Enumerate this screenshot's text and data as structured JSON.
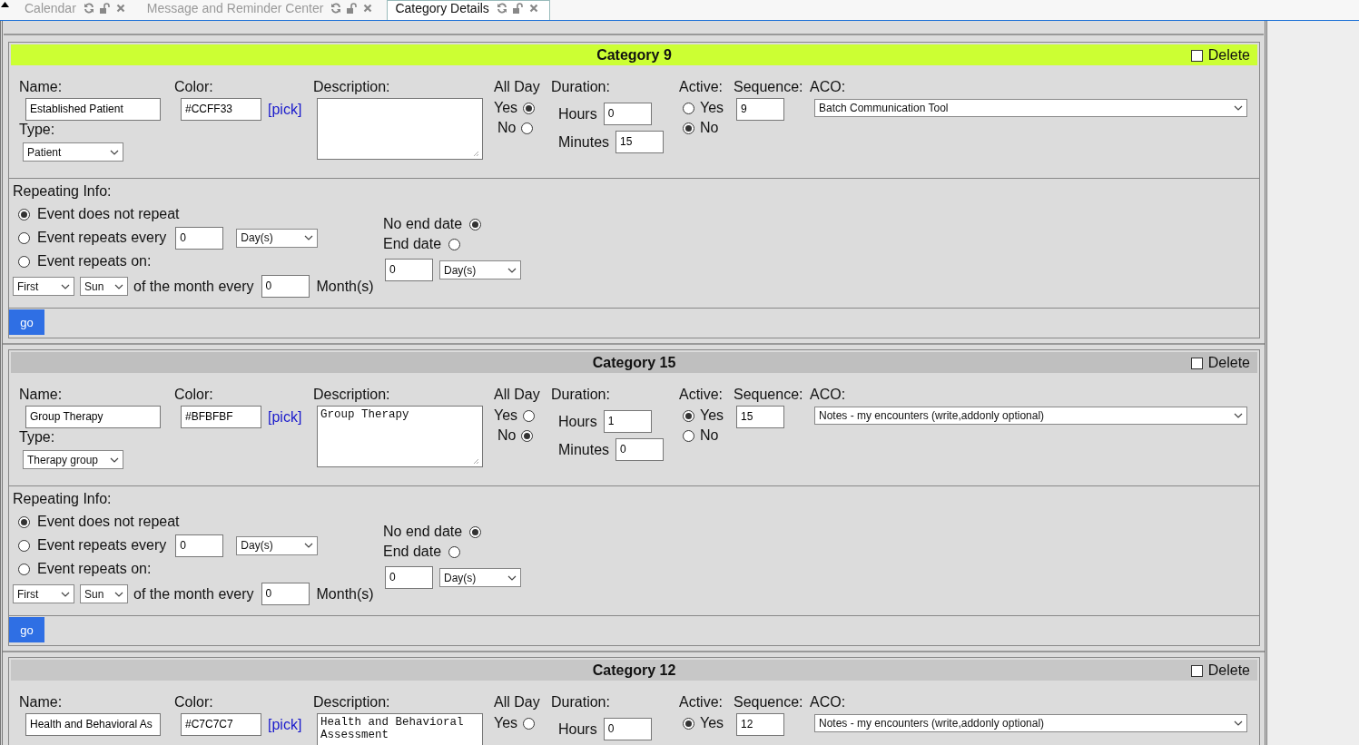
{
  "tabs": [
    {
      "label": "Calendar",
      "selected": false
    },
    {
      "label": "Message and Reminder Center",
      "selected": false
    },
    {
      "label": "Category Details",
      "selected": true
    }
  ],
  "categories": [
    {
      "title": "Category 9",
      "delete": {
        "label": "Delete",
        "checked": false
      },
      "name": {
        "label": "Name:",
        "value": "Established Patient"
      },
      "color": {
        "label": "Color:",
        "value": "#CCFF33",
        "link": "[pick]"
      },
      "type": {
        "label": "Type:",
        "value": "Patient"
      },
      "description": {
        "label": "Description:"
      },
      "all_day": {
        "label": "All Day",
        "options": [
          {
            "label": "Yes",
            "selected": true
          },
          {
            "label": "No",
            "selected": false
          }
        ]
      },
      "duration": {
        "label": "Duration:",
        "hours_label": "Hours",
        "hours": "0",
        "minutes_label": "Minutes",
        "minutes": "15"
      },
      "active": {
        "label": "Active:",
        "options": [
          {
            "label": "Yes",
            "selected": false
          },
          {
            "label": "No",
            "selected": true
          }
        ]
      },
      "sequence": {
        "label": "Sequence:",
        "value": "9"
      },
      "aco": {
        "label": "ACO:",
        "value": "Batch Communication Tool"
      },
      "repeating": {
        "label": "Repeating Info:",
        "options": [
          {
            "label": "Event does not repeat",
            "selected": true
          },
          {
            "label": "Event repeats every",
            "selected": false
          },
          {
            "label": "Event repeats on:",
            "selected": false
          }
        ],
        "every_value": "0",
        "every_unit": "Day(s)",
        "on_ordinal": "First",
        "on_day": "Sun",
        "month_text": "of the month every",
        "month_value": "0",
        "month_unit": "Month(s)",
        "end": [
          {
            "label": "No end date",
            "selected": true
          },
          {
            "label": "End date",
            "selected": false
          }
        ],
        "end_value": "0",
        "end_unit": "Day(s)"
      },
      "go": "go"
    },
    {
      "title": "Category 15",
      "delete": {
        "label": "Delete",
        "checked": false
      },
      "name": {
        "label": "Name:",
        "value": "Group Therapy"
      },
      "color": {
        "label": "Color:",
        "value": "#BFBFBF",
        "link": "[pick]"
      },
      "type": {
        "label": "Type:",
        "value": "Therapy group"
      },
      "description": {
        "label": "Description:",
        "value": "Group Therapy"
      },
      "all_day": {
        "label": "All Day",
        "options": [
          {
            "label": "Yes",
            "selected": false
          },
          {
            "label": "No",
            "selected": true
          }
        ]
      },
      "duration": {
        "label": "Duration:",
        "hours_label": "Hours",
        "hours": "1",
        "minutes_label": "Minutes",
        "minutes": "0"
      },
      "active": {
        "label": "Active:",
        "options": [
          {
            "label": "Yes",
            "selected": true
          },
          {
            "label": "No",
            "selected": false
          }
        ]
      },
      "sequence": {
        "label": "Sequence:",
        "value": "15"
      },
      "aco": {
        "label": "ACO:",
        "value": "Notes - my encounters (write,addonly optional)"
      },
      "repeating": {
        "label": "Repeating Info:",
        "options": [
          {
            "label": "Event does not repeat",
            "selected": true
          },
          {
            "label": "Event repeats every",
            "selected": false
          },
          {
            "label": "Event repeats on:",
            "selected": false
          }
        ],
        "every_value": "0",
        "every_unit": "Day(s)",
        "on_ordinal": "First",
        "on_day": "Sun",
        "month_text": "of the month every",
        "month_value": "0",
        "month_unit": "Month(s)",
        "end": [
          {
            "label": "No end date",
            "selected": true
          },
          {
            "label": "End date",
            "selected": false
          }
        ],
        "end_value": "0",
        "end_unit": "Day(s)"
      },
      "go": "go"
    },
    {
      "title": "Category 12",
      "delete": {
        "label": "Delete",
        "checked": false
      },
      "name": {
        "label": "Name:",
        "value": "Health and Behavioral As"
      },
      "color": {
        "label": "Color:",
        "value": "#C7C7C7",
        "link": "[pick]"
      },
      "description": {
        "label": "Description:",
        "value": "Health and Behavioral Assessment"
      },
      "all_day": {
        "label": "All Day",
        "options": [
          {
            "label": "Yes",
            "selected": false
          }
        ]
      },
      "duration": {
        "label": "Duration:",
        "hours_label": "Hours",
        "hours": "0"
      },
      "active": {
        "label": "Active:",
        "options": [
          {
            "label": "Yes",
            "selected": true
          }
        ]
      },
      "sequence": {
        "label": "Sequence:",
        "value": "12"
      },
      "aco": {
        "label": "ACO:",
        "value": "Notes - my encounters (write,addonly optional)"
      }
    }
  ]
}
